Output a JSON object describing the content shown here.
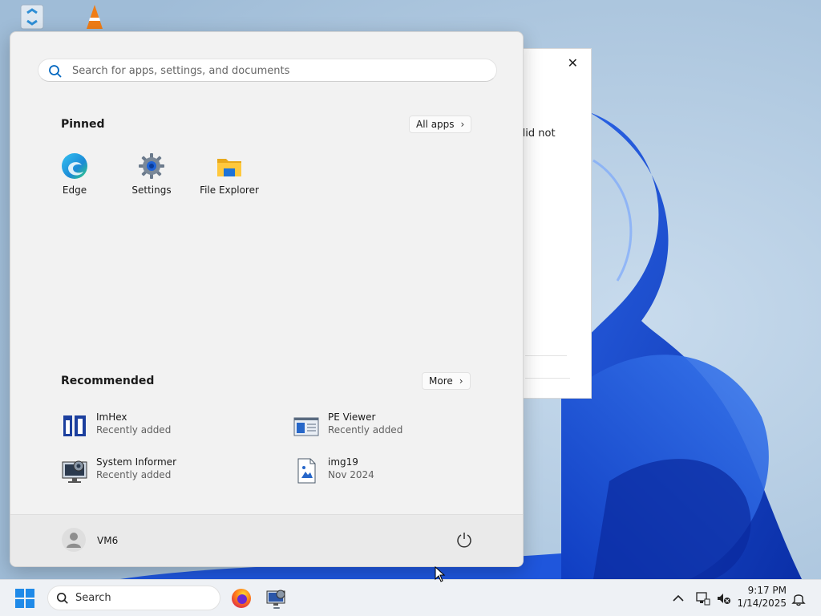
{
  "desktop": {
    "icons": [
      {
        "name": "Recycle Bin",
        "icon": "recycle-bin-icon"
      },
      {
        "name": "VLC media player",
        "icon": "vlc-icon"
      }
    ]
  },
  "background_dialog": {
    "close_symbol": "✕",
    "text_fragment": "did not"
  },
  "start_menu": {
    "search_placeholder": "Search for apps, settings, and documents",
    "pinned": {
      "title": "Pinned",
      "all_apps_label": "All apps",
      "apps": [
        {
          "label": "Edge",
          "icon": "edge-icon"
        },
        {
          "label": "Settings",
          "icon": "settings-gear-icon"
        },
        {
          "label": "File Explorer",
          "icon": "folder-icon"
        }
      ]
    },
    "recommended": {
      "title": "Recommended",
      "more_label": "More",
      "items": [
        {
          "name": "ImHex",
          "sub": "Recently added",
          "icon": "imhex-icon"
        },
        {
          "name": "PE Viewer",
          "sub": "Recently added",
          "icon": "pe-viewer-icon"
        },
        {
          "name": "System Informer",
          "sub": "Recently added",
          "icon": "system-informer-icon"
        },
        {
          "name": "img19",
          "sub": "Nov 2024",
          "icon": "image-file-icon"
        }
      ]
    },
    "footer": {
      "user_name": "VM6",
      "power_icon": "power-icon"
    }
  },
  "taskbar": {
    "search_label": "Search",
    "apps": [
      {
        "icon": "firefox-icon"
      },
      {
        "icon": "system-informer-icon"
      }
    ],
    "tray": {
      "time": "9:17 PM",
      "date": "1/14/2025"
    }
  },
  "colors": {
    "accent": "#0067c0",
    "menu_background": "#f2f2f2",
    "taskbar_background": "#eef1f5",
    "wallpaper_blue": "#1a4fd1"
  }
}
